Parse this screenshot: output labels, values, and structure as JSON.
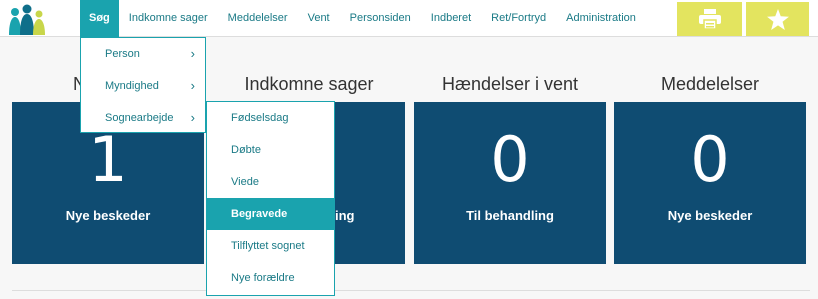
{
  "nav": {
    "items": [
      {
        "label": "Søg"
      },
      {
        "label": "Indkomne sager"
      },
      {
        "label": "Meddelelser"
      },
      {
        "label": "Vent"
      },
      {
        "label": "Personsiden"
      },
      {
        "label": "Indberet"
      },
      {
        "label": "Ret/Fortryd"
      },
      {
        "label": "Administration"
      }
    ],
    "active_index": 0,
    "print_icon": "printer-icon",
    "star_icon": "star-icon"
  },
  "cards": [
    {
      "heading": "Nyt fra K",
      "number": "1",
      "label": "Nye beskeder"
    },
    {
      "heading": "Indkomne sager",
      "number": "",
      "label": "ing"
    },
    {
      "heading": "Hændelser i vent",
      "number": "0",
      "label": "Til behandling"
    },
    {
      "heading": "Meddelelser",
      "number": "0",
      "label": "Nye beskeder"
    }
  ],
  "dropdown": {
    "items": [
      {
        "label": "Person"
      },
      {
        "label": "Myndighed"
      },
      {
        "label": "Sognearbejde"
      }
    ],
    "chevron_icon": "chevron-right-icon"
  },
  "submenu": {
    "items": [
      {
        "label": "Fødselsdag"
      },
      {
        "label": "Døbte"
      },
      {
        "label": "Viede"
      },
      {
        "label": "Begravede"
      },
      {
        "label": "Tilflyttet sognet"
      },
      {
        "label": "Nye forældre"
      }
    ],
    "active_index": 3
  },
  "colors": {
    "teal": "#1aa3ae",
    "nav_text": "#1a7a86",
    "card_bg": "#0f4c72",
    "yellow": "#e3e45f"
  }
}
